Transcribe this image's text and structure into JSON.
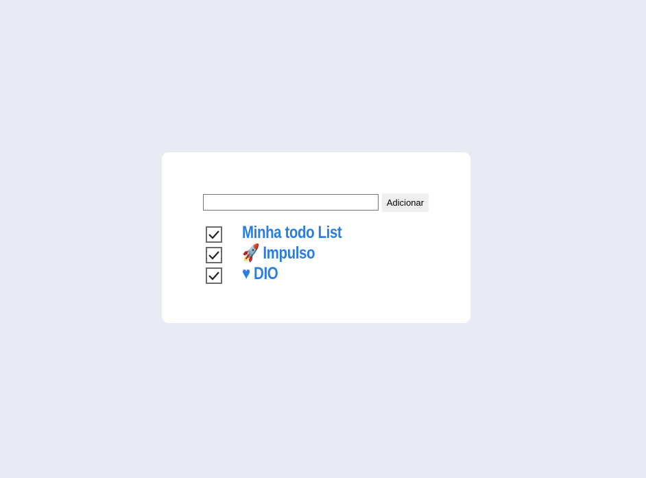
{
  "form": {
    "input_value": "",
    "input_placeholder": "",
    "add_label": "Adicionar"
  },
  "todos": [
    {
      "label": "Minha todo List",
      "checked": true
    },
    {
      "label": "🚀 Impulso",
      "checked": true
    },
    {
      "label": "♥ DIO",
      "checked": true
    }
  ],
  "colors": {
    "background": "#e8ebf4",
    "accent": "#2a7de1"
  }
}
